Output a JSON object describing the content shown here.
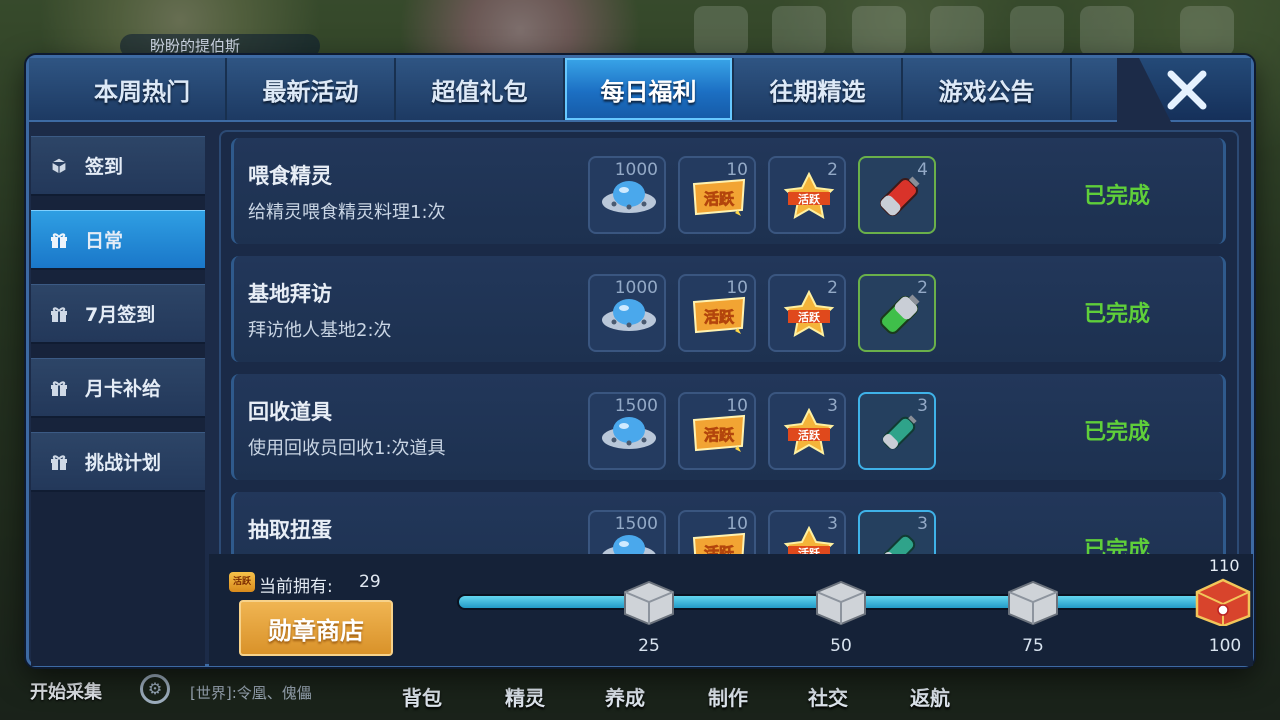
{
  "background": {
    "player_name": "盼盼的提伯斯",
    "bottom_start": "开始采集",
    "chat_text": "[世界]:令凰、傀儡",
    "bottom_nav": [
      "背包",
      "精灵",
      "养成",
      "制作",
      "社交",
      "返航"
    ]
  },
  "tabs": [
    {
      "label": "本周热门"
    },
    {
      "label": "最新活动"
    },
    {
      "label": "超值礼包"
    },
    {
      "label": "每日福利",
      "active": true
    },
    {
      "label": "往期精选"
    },
    {
      "label": "游戏公告"
    }
  ],
  "sidebar": {
    "items": [
      {
        "label": "签到",
        "icon": "cube-icon"
      },
      {
        "label": "日常",
        "icon": "gift-icon",
        "active": true
      },
      {
        "label": "7月签到",
        "icon": "gift-icon"
      },
      {
        "label": "月卡补给",
        "icon": "gift-icon"
      },
      {
        "label": "挑战计划",
        "icon": "gift-icon"
      }
    ]
  },
  "tasks": [
    {
      "title": "喂食精灵",
      "desc": "给精灵喂食精灵料理1:次",
      "rewards": [
        {
          "icon": "ufo-coin-icon",
          "count": "1000"
        },
        {
          "icon": "activity-badge-icon",
          "count": "10"
        },
        {
          "icon": "activity-star-icon",
          "count": "2"
        },
        {
          "icon": "red-battery-icon",
          "count": "4"
        }
      ],
      "status": "已完成"
    },
    {
      "title": "基地拜访",
      "desc": "拜访他人基地2:次",
      "rewards": [
        {
          "icon": "ufo-coin-icon",
          "count": "1000"
        },
        {
          "icon": "activity-badge-icon",
          "count": "10"
        },
        {
          "icon": "activity-star-icon",
          "count": "2"
        },
        {
          "icon": "green-battery-icon",
          "count": "2"
        }
      ],
      "status": "已完成"
    },
    {
      "title": "回收道具",
      "desc": "使用回收员回收1:次道具",
      "rewards": [
        {
          "icon": "ufo-coin-icon",
          "count": "1500"
        },
        {
          "icon": "activity-badge-icon",
          "count": "10"
        },
        {
          "icon": "activity-star-icon",
          "count": "3"
        },
        {
          "icon": "teal-battery-icon",
          "count": "3"
        }
      ],
      "status": "已完成"
    },
    {
      "title": "抽取扭蛋",
      "desc": "",
      "rewards": [
        {
          "icon": "ufo-coin-icon",
          "count": "1500"
        },
        {
          "icon": "activity-badge-icon",
          "count": "10"
        },
        {
          "icon": "activity-star-icon",
          "count": "3"
        },
        {
          "icon": "teal-battery-icon",
          "count": "3"
        }
      ],
      "status": "已完成"
    }
  ],
  "reward_badge_text": "活跃",
  "progress": {
    "owned_badge": "活跃",
    "owned_label": "当前拥有:",
    "owned_value": "29",
    "shop_button": "勋章商店",
    "current": 29,
    "max": 100,
    "max_label": "110",
    "milestones": [
      "25",
      "50",
      "75",
      "100"
    ],
    "colors": {
      "fill": "#3fb4d8",
      "shop": "#e8a43e",
      "done": "#5fcf3a"
    }
  }
}
